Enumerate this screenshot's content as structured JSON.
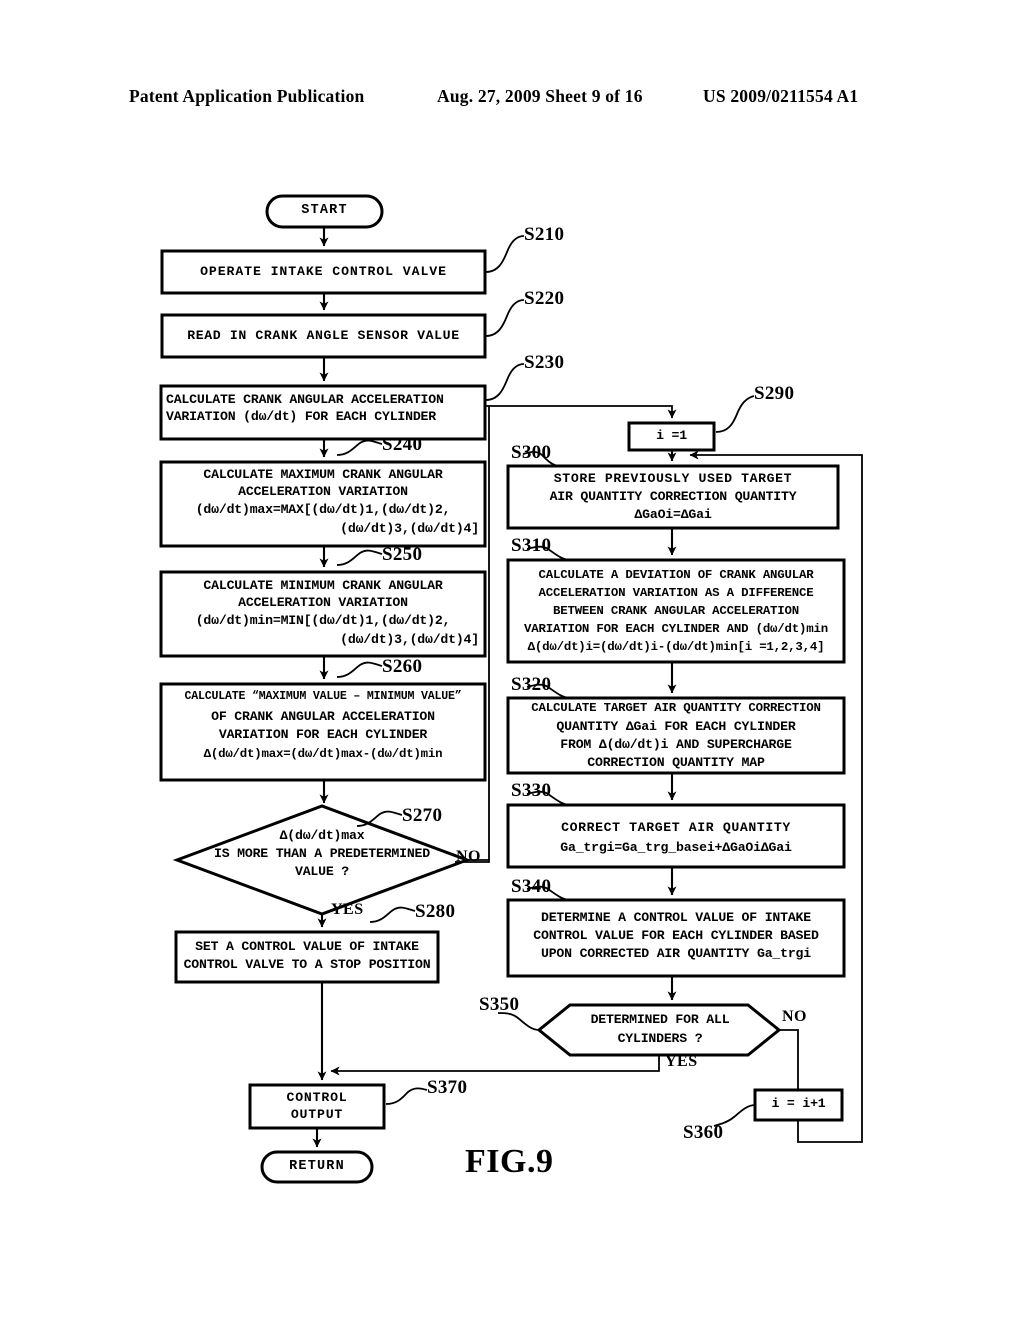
{
  "header": {
    "publication": "Patent Application Publication",
    "date_sheet": "Aug. 27, 2009  Sheet 9 of 16",
    "patent_number": "US 2009/0211554 A1"
  },
  "figure": {
    "label": "FIG.9"
  },
  "flowchart": {
    "terminators": {
      "start": "START",
      "return": "RETURN"
    },
    "nodes": {
      "s210": {
        "step": "S210",
        "text": "OPERATE INTAKE CONTROL VALVE"
      },
      "s220": {
        "step": "S220",
        "text": "READ IN CRANK ANGLE SENSOR VALUE"
      },
      "s230": {
        "step": "S230",
        "line1": "CALCULATE CRANK ANGULAR ACCELERATION",
        "line2": "VARIATION (dω/dt) FOR EACH CYLINDER"
      },
      "s240": {
        "step": "S240",
        "line1": "CALCULATE MAXIMUM CRANK ANGULAR",
        "line2": "ACCELERATION VARIATION",
        "line3": "(dω/dt)max=MAX[(dω/dt)1,(dω/dt)2,",
        "line4": "(dω/dt)3,(dω/dt)4]"
      },
      "s250": {
        "step": "S250",
        "line1": "CALCULATE MINIMUM CRANK ANGULAR",
        "line2": "ACCELERATION VARIATION",
        "line3": "(dω/dt)min=MIN[(dω/dt)1,(dω/dt)2,",
        "line4": "(dω/dt)3,(dω/dt)4]"
      },
      "s260": {
        "step": "S260",
        "line1": "CALCULATE “MAXIMUM VALUE – MINIMUM VALUE”",
        "line2": "OF CRANK ANGULAR ACCELERATION",
        "line3": "VARIATION FOR EACH CYLINDER",
        "line4": "Δ(dω/dt)max=(dω/dt)max-(dω/dt)min"
      },
      "s270": {
        "step": "S270",
        "line1": "Δ(dω/dt)max",
        "line2": "IS MORE THAN A PREDETERMINED",
        "line3": "VALUE ?",
        "yes": "YES",
        "no": "NO"
      },
      "s280": {
        "step": "S280",
        "line1": "SET A CONTROL VALUE OF INTAKE",
        "line2": "CONTROL VALVE TO A STOP POSITION"
      },
      "s290": {
        "step": "S290",
        "text": "i =1"
      },
      "s300": {
        "step": "S300",
        "line1": "STORE PREVIOUSLY USED TARGET",
        "line2": "AIR QUANTITY CORRECTION QUANTITY",
        "line3": "ΔGaOi=ΔGai"
      },
      "s310": {
        "step": "S310",
        "line1": "CALCULATE A DEVIATION OF CRANK ANGULAR",
        "line2": "ACCELERATION VARIATION AS A DIFFERENCE",
        "line3": "BETWEEN CRANK ANGULAR ACCELERATION",
        "line4": "VARIATION FOR EACH CYLINDER AND (dω/dt)min",
        "line5": "Δ(dω/dt)i=(dω/dt)i-(dω/dt)min[i =1,2,3,4]"
      },
      "s320": {
        "step": "S320",
        "line1": "CALCULATE TARGET AIR QUANTITY CORRECTION",
        "line2": "QUANTITY ΔGai FOR EACH CYLINDER",
        "line3": "FROM Δ(dω/dt)i AND SUPERCHARGE",
        "line4": "CORRECTION QUANTITY MAP"
      },
      "s330": {
        "step": "S330",
        "line1": "CORRECT TARGET AIR QUANTITY",
        "line2": "Ga_trgi=Ga_trg_basei+ΔGaOiΔGai"
      },
      "s340": {
        "step": "S340",
        "line1": "DETERMINE A CONTROL VALUE OF INTAKE",
        "line2": "CONTROL VALUE FOR EACH CYLINDER BASED",
        "line3": "UPON CORRECTED AIR QUANTITY Ga_trgi"
      },
      "s350": {
        "step": "S350",
        "line1": "DETERMINED FOR ALL",
        "line2": "CYLINDERS ?",
        "yes": "YES",
        "no": "NO"
      },
      "s360": {
        "step": "S360",
        "text": "i = i+1"
      },
      "s370": {
        "step": "S370",
        "line1": "CONTROL",
        "line2": "OUTPUT"
      }
    }
  }
}
